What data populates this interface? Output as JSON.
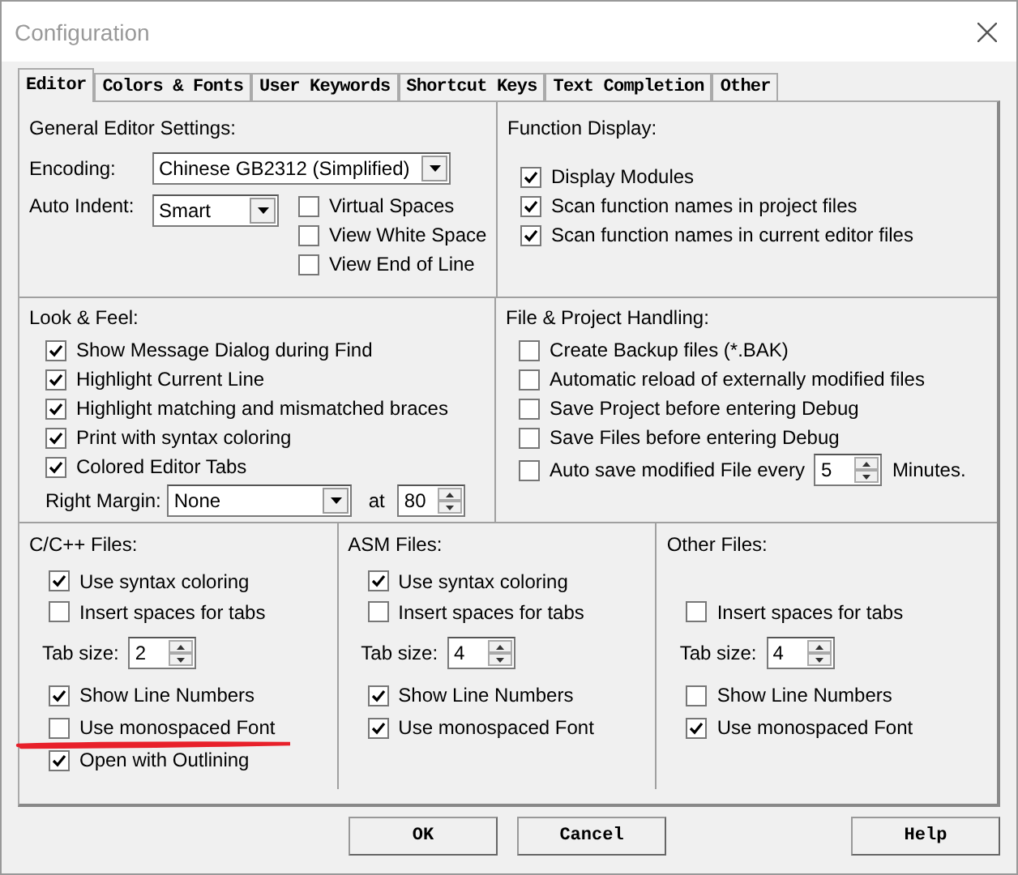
{
  "window": {
    "title": "Configuration"
  },
  "tabs": [
    {
      "label": "Editor",
      "selected": true
    },
    {
      "label": "Colors & Fonts",
      "selected": false
    },
    {
      "label": "User Keywords",
      "selected": false
    },
    {
      "label": "Shortcut Keys",
      "selected": false
    },
    {
      "label": "Text Completion",
      "selected": false
    },
    {
      "label": "Other",
      "selected": false
    }
  ],
  "general": {
    "heading": "General Editor Settings:",
    "encoding": {
      "label": "Encoding:",
      "value": "Chinese GB2312 (Simplified)"
    },
    "auto_indent": {
      "label": "Auto Indent:",
      "value": "Smart"
    },
    "options": [
      {
        "label": "Virtual Spaces",
        "checked": false
      },
      {
        "label": "View White Space",
        "checked": false
      },
      {
        "label": "View End of Line",
        "checked": false
      }
    ]
  },
  "function_display": {
    "heading": "Function Display:",
    "options": [
      {
        "label": "Display Modules",
        "checked": true
      },
      {
        "label": "Scan function names in project files",
        "checked": true
      },
      {
        "label": "Scan function names in current editor files",
        "checked": true
      }
    ]
  },
  "look_and_feel": {
    "heading": "Look & Feel:",
    "options": [
      {
        "label": "Show Message Dialog during Find",
        "checked": true
      },
      {
        "label": "Highlight Current Line",
        "checked": true
      },
      {
        "label": "Highlight matching and mismatched braces",
        "checked": true
      },
      {
        "label": "Print with syntax coloring",
        "checked": true
      },
      {
        "label": "Colored Editor Tabs",
        "checked": true
      }
    ],
    "right_margin": {
      "label": "Right Margin:",
      "value": "None",
      "at_label": "at",
      "at_value": "80"
    }
  },
  "file_handling": {
    "heading": "File & Project Handling:",
    "options": [
      {
        "label": "Create Backup files (*.BAK)",
        "checked": false
      },
      {
        "label": "Automatic reload of externally modified files",
        "checked": false
      },
      {
        "label": "Save Project before entering Debug",
        "checked": false
      },
      {
        "label": "Save Files before entering Debug",
        "checked": false
      }
    ],
    "auto_save": {
      "label": "Auto save modified File every",
      "checked": false,
      "value": "5",
      "unit": "Minutes."
    }
  },
  "file_types": [
    {
      "heading": "C/C++ Files:",
      "syntax_coloring": {
        "label": "Use syntax coloring",
        "checked": true
      },
      "spaces_for_tabs": {
        "label": "Insert spaces for tabs",
        "checked": false
      },
      "tab_size": {
        "label": "Tab size:",
        "value": "2"
      },
      "line_numbers": {
        "label": "Show Line Numbers",
        "checked": true
      },
      "monospaced_font": {
        "label": "Use monospaced Font",
        "checked": false
      },
      "outlining": {
        "label": "Open with Outlining",
        "checked": true
      }
    },
    {
      "heading": "ASM Files:",
      "syntax_coloring": {
        "label": "Use syntax coloring",
        "checked": true
      },
      "spaces_for_tabs": {
        "label": "Insert spaces for tabs",
        "checked": false
      },
      "tab_size": {
        "label": "Tab size:",
        "value": "4"
      },
      "line_numbers": {
        "label": "Show Line Numbers",
        "checked": true
      },
      "monospaced_font": {
        "label": "Use monospaced Font",
        "checked": true
      }
    },
    {
      "heading": "Other Files:",
      "spaces_for_tabs": {
        "label": "Insert spaces for tabs",
        "checked": false
      },
      "tab_size": {
        "label": "Tab size:",
        "value": "4"
      },
      "line_numbers": {
        "label": "Show Line Numbers",
        "checked": false
      },
      "monospaced_font": {
        "label": "Use monospaced Font",
        "checked": true
      }
    }
  ],
  "buttons": [
    "OK",
    "Cancel"
  ],
  "help_button": "Help"
}
